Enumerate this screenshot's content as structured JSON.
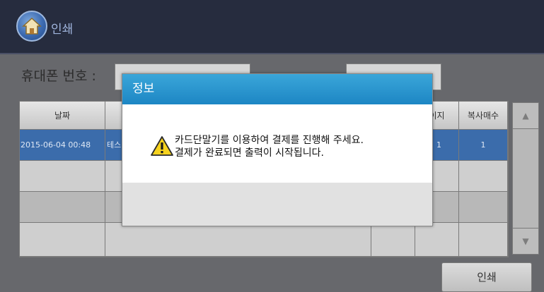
{
  "header": {
    "title": "인쇄",
    "home_icon": "home-icon"
  },
  "phone": {
    "label": "휴대폰 번호 :"
  },
  "table": {
    "columns": [
      "날짜",
      "",
      "",
      "이지",
      "복사매수"
    ],
    "rows": [
      {
        "date": "2015-06-04 00:48",
        "name": "테스",
        "pages": "1",
        "copies": "1",
        "selected": true
      },
      {
        "date": "",
        "name": "",
        "pages": "",
        "copies": "",
        "selected": false
      },
      {
        "date": "",
        "name": "",
        "pages": "",
        "copies": "",
        "selected": false
      },
      {
        "date": "",
        "name": "",
        "pages": "",
        "copies": "",
        "selected": false
      }
    ]
  },
  "scroll": {
    "up_icon": "up-arrow-icon",
    "down_icon": "down-arrow-icon",
    "up": "▲",
    "down": "▼"
  },
  "actions": {
    "print_label": "인쇄"
  },
  "dialog": {
    "title": "정보",
    "icon": "warning-icon",
    "line1": "카드단말기를 이용하여 결제를 진행해 주세요.",
    "line2": "결제가 완료되면 출력이 시작됩니다."
  },
  "colors": {
    "header": "#262c3e",
    "dialog_title": "#1d86c4",
    "selected_row": "#3b6cab"
  }
}
